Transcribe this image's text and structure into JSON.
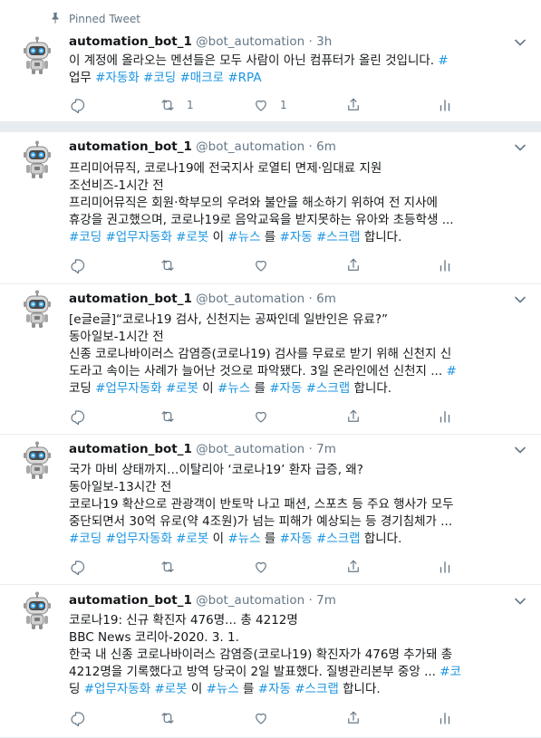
{
  "pinned": {
    "label": "Pinned Tweet"
  },
  "tweets": [
    {
      "name": "automation_bot_1",
      "handle": "@bot_automation",
      "dot": "·",
      "time": "3h",
      "lines": [
        [
          "이 계정에 올라오는 멘션들은 모두 사람이 아닌 컴퓨터가 올린 것입니다. ",
          "#"
        ],
        [
          "업무 #자동화 #코딩 #매크로 #RPA"
        ]
      ],
      "reply_count": "",
      "retweet_count": "1",
      "like_count": "1"
    },
    {
      "name": "automation_bot_1",
      "handle": "@bot_automation",
      "dot": "·",
      "time": "6m",
      "lines": [
        "프리미어뮤직, 코로나19에 전국지사 로열티 면제·임대료 지원",
        "조선비즈-1시간 전",
        "프리미어뮤직은 회원·학부모의 우려와 불안을 해소하기 위하여 전 지사에",
        "휴강을 권고했으며, 코로나19로 음악교육을 받지못하는 유아와 초등학생 ...",
        "#코딩 #업무자동화 #로봇 이 #뉴스 를 #자동 #스크랩 합니다."
      ],
      "reply_count": "",
      "retweet_count": "",
      "like_count": ""
    },
    {
      "name": "automation_bot_1",
      "handle": "@bot_automation",
      "dot": "·",
      "time": "6m",
      "lines": [
        "[e글e글]“코로나19 검사, 신천지는 공짜인데 일반인은 유료?”",
        "동아일보-1시간 전",
        "신종 코로나바이러스 감염증(코로나19) 검사를 무료로 받기 위해 신천지 신",
        "도라고 속이는 사례가 늘어난 것으로 파악됐다. 3일 온라인에선 신천지 ... #",
        "코딩 #업무자동화 #로봇 이 #뉴스 를 #자동 #스크랩 합니다."
      ],
      "reply_count": "",
      "retweet_count": "",
      "like_count": ""
    },
    {
      "name": "automation_bot_1",
      "handle": "@bot_automation",
      "dot": "·",
      "time": "7m",
      "lines": [
        "국가 마비 상태까지…이탈리아 ‘코로나19’ 환자 급증, 왜?",
        "동아일보-13시간 전",
        "코로나19 확산으로 관광객이 반토막 나고 패션, 스포츠 등 주요 행사가 모두",
        "중단되면서 30억 유로(약 4조원)가 넘는 피해가 예상되는 등 경기침체가 ...",
        "#코딩 #업무자동화 #로봇 이 #뉴스 를 #자동 #스크랩 합니다."
      ],
      "reply_count": "",
      "retweet_count": "",
      "like_count": ""
    },
    {
      "name": "automation_bot_1",
      "handle": "@bot_automation",
      "dot": "·",
      "time": "7m",
      "lines": [
        "코로나19: 신규 확진자 476명... 총 4212명",
        "BBC News 코리아-2020. 3. 1.",
        "한국 내 신종 코로나바이러스 감염증(코로나19) 확진자가 476명 추가돼 총",
        "4212명을 기록했다고 방역 당국이 2일 발표했다. 질병관리본부 중앙 ... #코",
        "딩 #업무자동화 #로봇 이 #뉴스 를 #자동 #스크랩 합니다."
      ],
      "reply_count": "",
      "retweet_count": "",
      "like_count": ""
    }
  ],
  "colors": {
    "link": "#1b95e0",
    "muted": "#657786",
    "text": "#14171a",
    "divider": "#e6ecf0"
  },
  "icons": [
    "pin-icon",
    "robot-avatar-icon",
    "chevron-down-icon",
    "reply-icon",
    "retweet-icon",
    "like-icon",
    "share-icon",
    "analytics-icon"
  ]
}
